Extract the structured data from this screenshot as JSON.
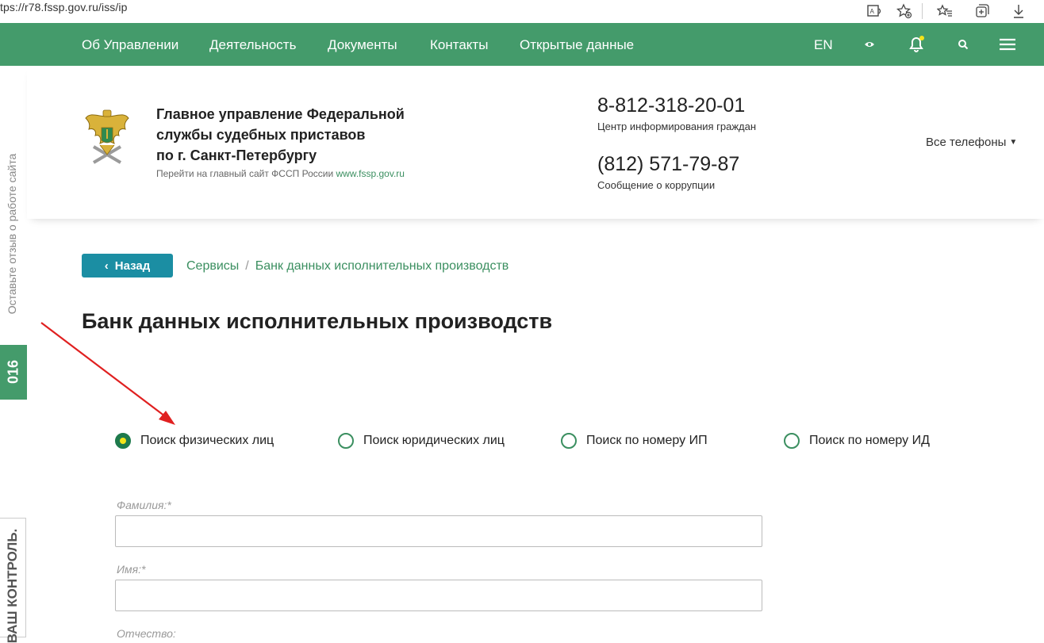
{
  "browser": {
    "url": "tps://r78.fssp.gov.ru/iss/ip",
    "icons": [
      "read-aloud-icon",
      "favorite-add-icon",
      "favorites-icon",
      "collections-icon",
      "download-icon"
    ]
  },
  "nav": {
    "items": [
      "Об Управлении",
      "Деятельность",
      "Документы",
      "Контакты",
      "Открытые данные"
    ],
    "lang": "EN",
    "icons": [
      "eye-icon",
      "bell-icon",
      "search-icon",
      "menu-icon"
    ],
    "accent": "#449b6b"
  },
  "header": {
    "org_title_lines": [
      "Главное управление Федеральной",
      "службы судебных приставов",
      "по г. Санкт-Петербургу"
    ],
    "org_sub_text": "Перейти на главный сайт ФССП России",
    "org_sub_link": "www.fssp.gov.ru",
    "phone1": "8-812-318-20-01",
    "phone1_caption": "Центр информирования граждан",
    "phone2": "(812) 571-79-87",
    "phone2_caption": "Сообщение о коррупции",
    "all_phones": "Все телефоны"
  },
  "side": {
    "feedback": "Оставьте отзыв о работе сайта",
    "tab_016": "016",
    "tab_control": "ВАШ КОНТРОЛЬ."
  },
  "breadcrumb": {
    "back": "Назад",
    "items": [
      "Сервисы",
      "Банк данных исполнительных производств"
    ]
  },
  "page": {
    "title": "Банк данных исполнительных производств"
  },
  "search_modes": {
    "options": [
      "Поиск физических лиц",
      "Поиск юридических лиц",
      "Поиск по номеру ИП",
      "Поиск по номеру ИД"
    ],
    "selected": "Поиск физических лиц"
  },
  "form": {
    "fields": [
      {
        "label": "Фамилия:*",
        "value": ""
      },
      {
        "label": "Имя:*",
        "value": ""
      },
      {
        "label": "Отчество:",
        "value": ""
      }
    ]
  }
}
